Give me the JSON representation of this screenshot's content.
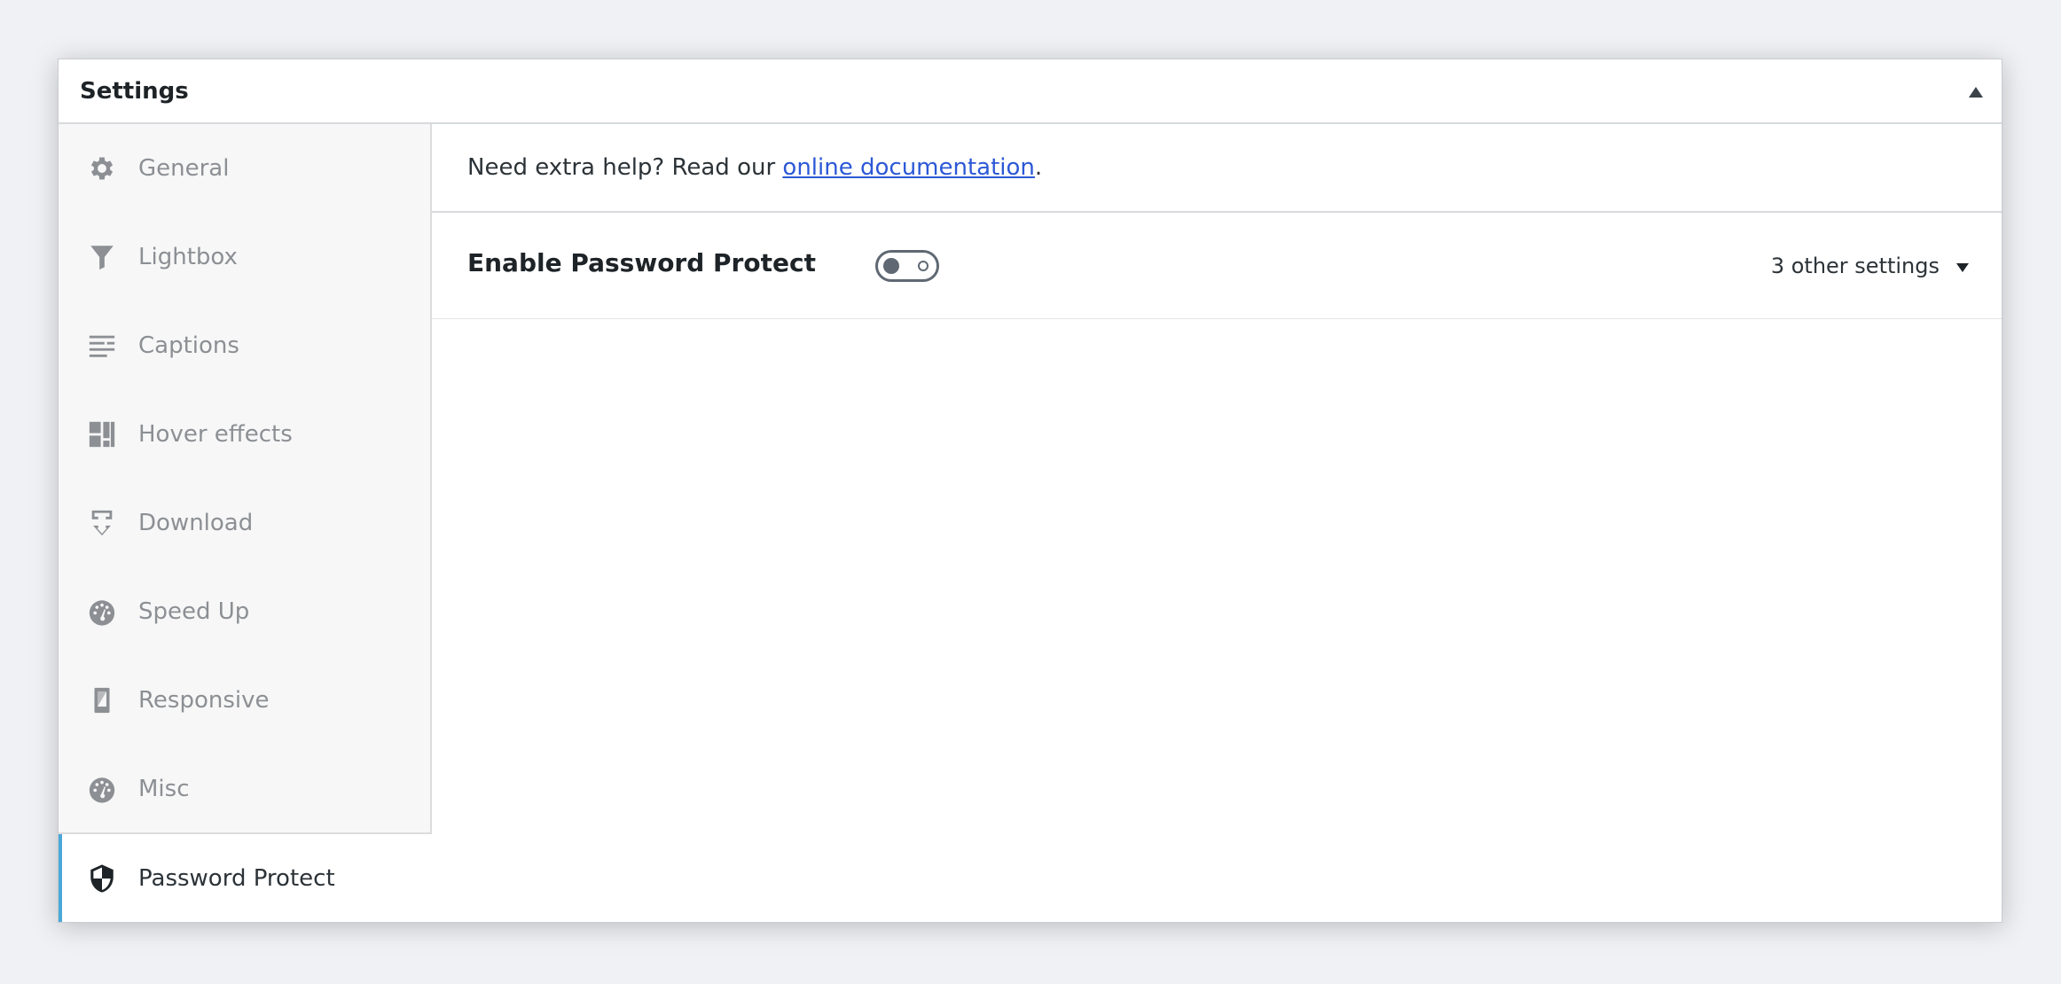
{
  "panel": {
    "title": "Settings",
    "collapse_icon": "triangle-up-icon"
  },
  "sidebar": {
    "items": [
      {
        "label": "General",
        "icon": "gear-icon",
        "active": false
      },
      {
        "label": "Lightbox",
        "icon": "funnel-icon",
        "active": false
      },
      {
        "label": "Captions",
        "icon": "text-align-icon",
        "active": false
      },
      {
        "label": "Hover effects",
        "icon": "layout-grid-icon",
        "active": false
      },
      {
        "label": "Download",
        "icon": "download-icon",
        "active": false
      },
      {
        "label": "Speed Up",
        "icon": "speedometer-icon",
        "active": false
      },
      {
        "label": "Responsive",
        "icon": "phone-icon",
        "active": false
      },
      {
        "label": "Misc",
        "icon": "speedometer-icon",
        "active": false
      },
      {
        "label": "Password Protect",
        "icon": "shield-icon",
        "active": true
      }
    ]
  },
  "help": {
    "prefix": "Need extra help? Read our ",
    "link_text": "online documentation",
    "suffix": "."
  },
  "setting": {
    "label": "Enable Password Protect",
    "toggle_on": false,
    "other_settings": "3 other settings"
  },
  "colors": {
    "accent": "#4aa8d8",
    "link": "#2c58d6",
    "sidebar_bg": "#f7f7f7",
    "inactive_text": "#8c8f94"
  }
}
